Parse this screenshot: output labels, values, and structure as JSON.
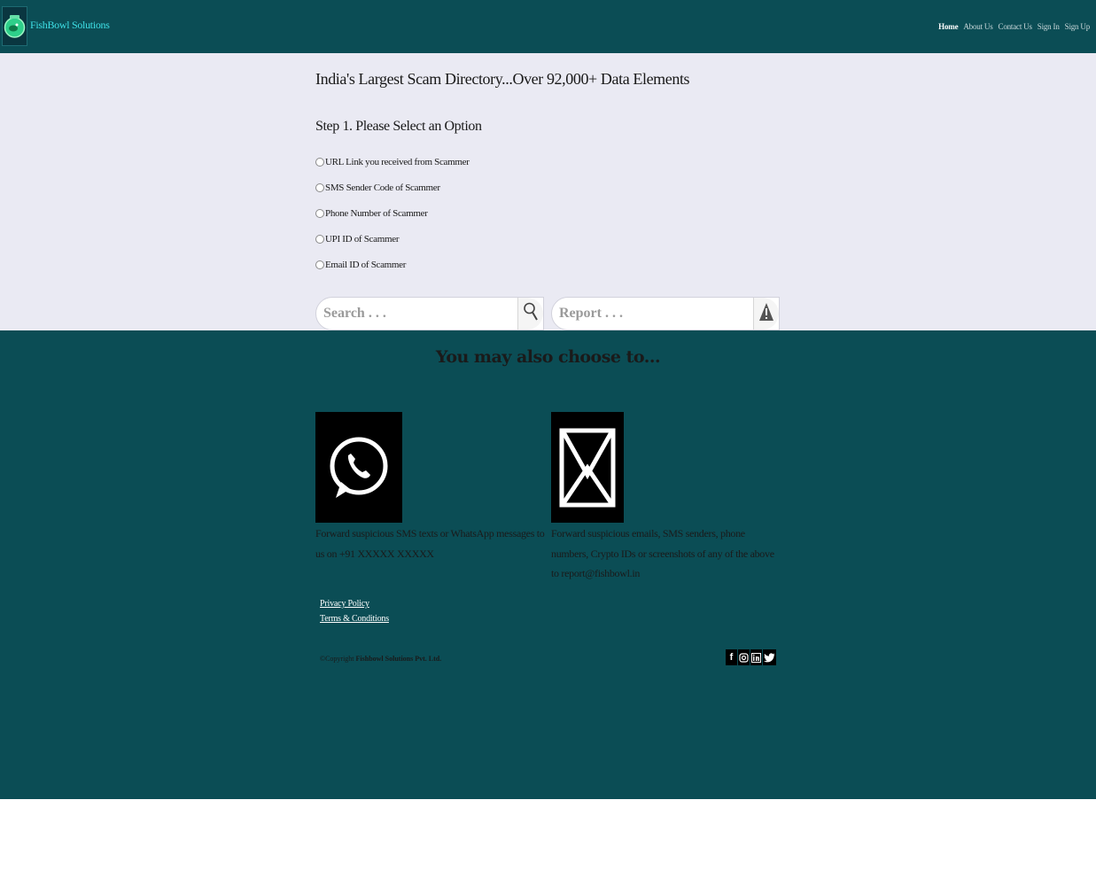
{
  "header": {
    "brand": "FishBowl Solutions",
    "nav": {
      "home": "Home",
      "about": "About Us",
      "contact": "Contact Us",
      "signin": "Sign In",
      "signup": "Sign Up"
    }
  },
  "main": {
    "headline": "India's Largest Scam Directory...Over 92,000+ Data Elements",
    "step_title": "Step 1. Please Select an Option",
    "options": [
      "URL Link you received from Scammer",
      "SMS Sender Code of Scammer",
      "Phone Number of Scammer",
      "UPI ID of Scammer",
      "Email ID of Scammer"
    ],
    "search_placeholder": "Search . . .",
    "report_placeholder": "Report . . ."
  },
  "footer": {
    "choose_title": "You may also choose to...",
    "whatsapp_text": "Forward suspicious SMS texts or WhatsApp messages to us on +91 XXXXX XXXXX",
    "email_text": "Forward suspicious emails, SMS senders, phone numbers, Crypto IDs or screenshots of any of the above to report@fishbowl.in",
    "privacy": "Privacy Policy",
    "terms": "Terms & Conditions",
    "copyright_prefix": "©Copyright",
    "copyright_company": "Fishbowl Solutions Pvt. Ltd."
  },
  "colors": {
    "header_bg": "#0b4d55",
    "section_bg": "#eaeaf3",
    "brand_text": "#3ee0e6"
  }
}
